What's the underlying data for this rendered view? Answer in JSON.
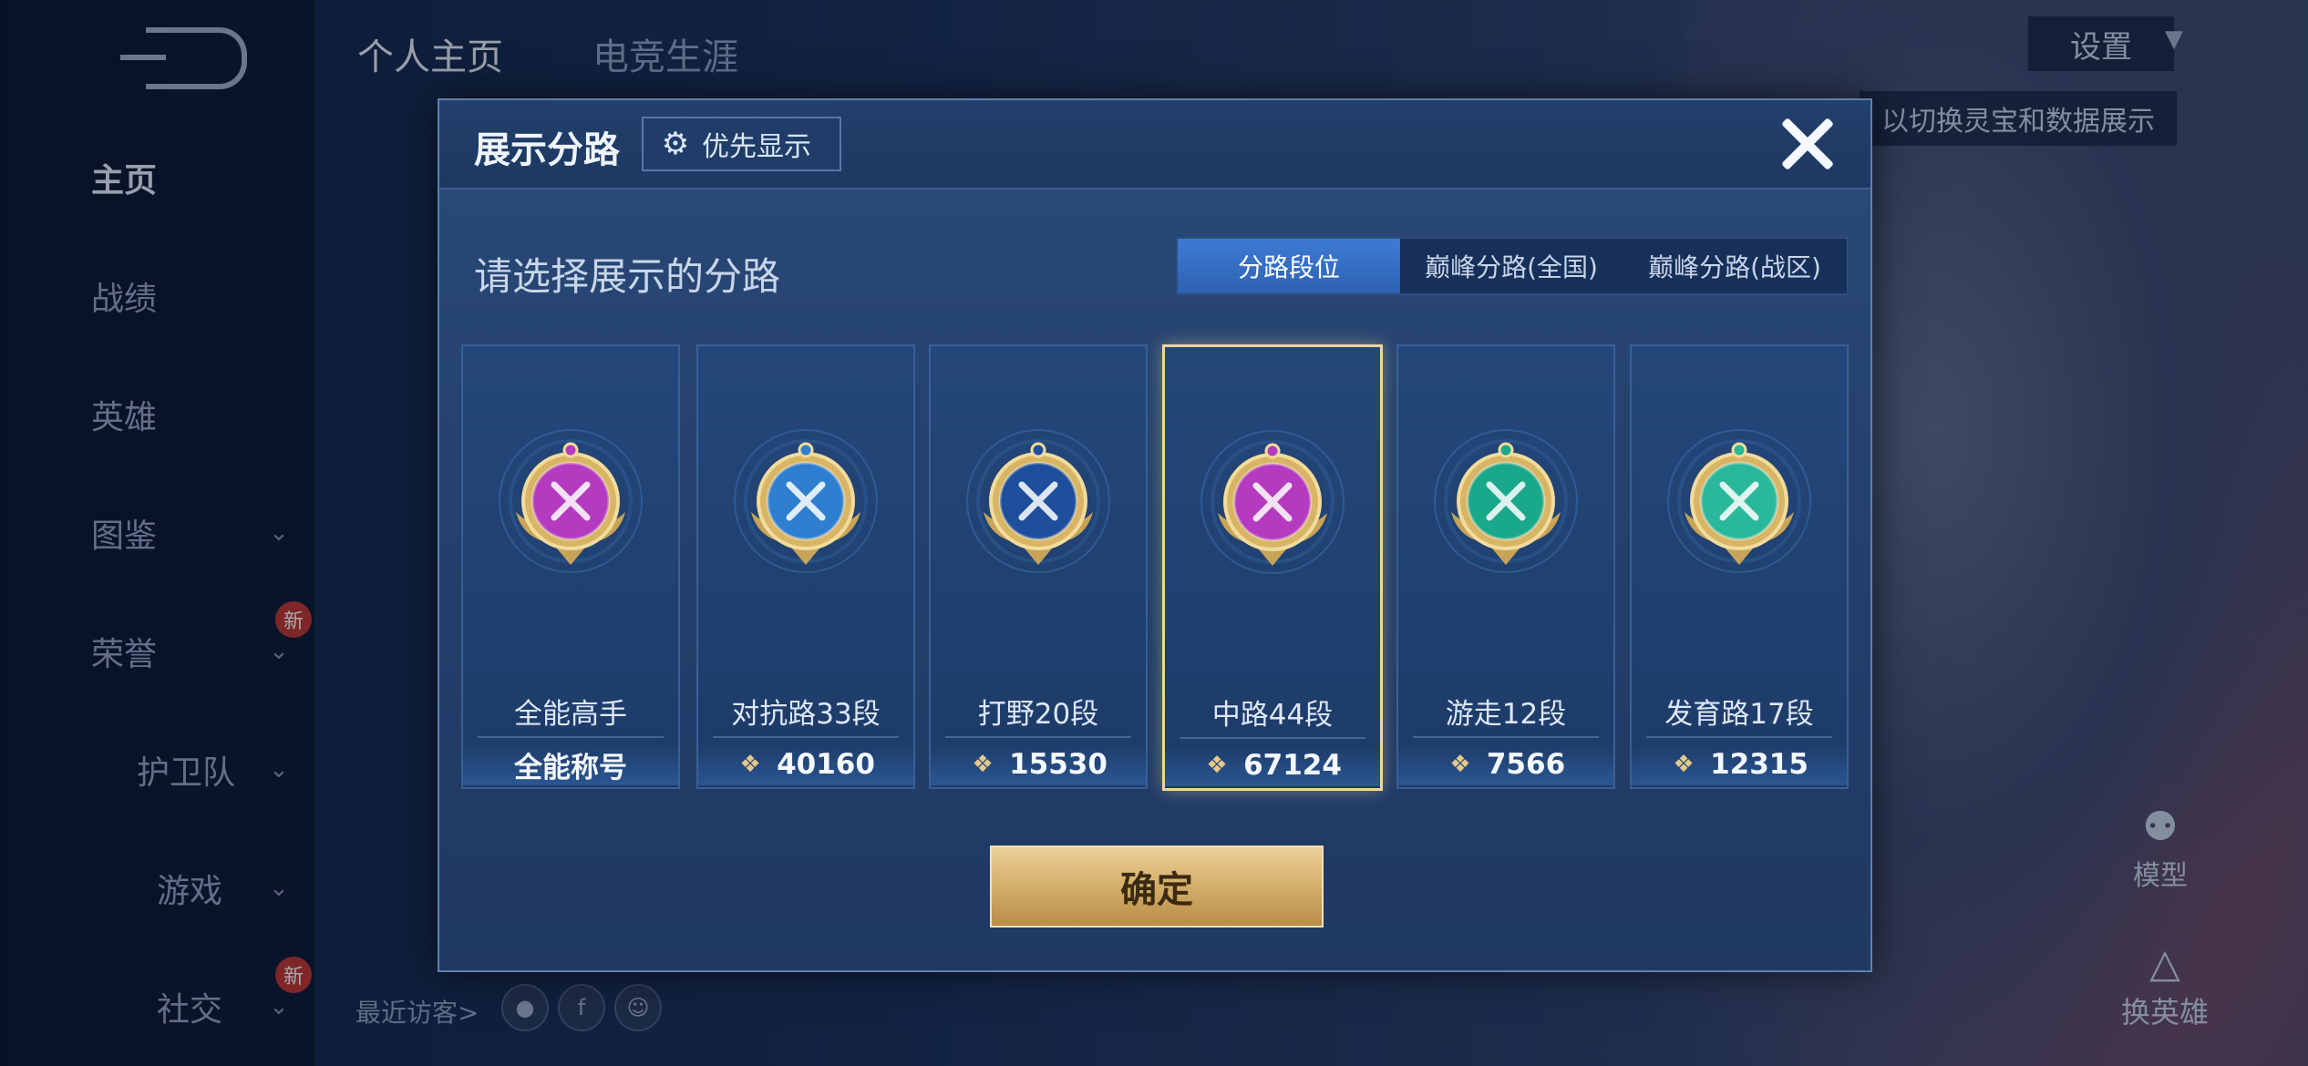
{
  "top_tabs": [
    "个人主页",
    "电竞生涯"
  ],
  "settings_label": "设置",
  "hint_text": "以切换灵宝和数据展示",
  "sidebar": {
    "items": [
      {
        "label": "主页"
      },
      {
        "label": "战绩"
      },
      {
        "label": "英雄"
      },
      {
        "label": "图鉴"
      },
      {
        "label": "荣誉"
      },
      {
        "label": "护卫队"
      },
      {
        "label": "游戏"
      },
      {
        "label": "社交"
      }
    ],
    "new_badge": "新"
  },
  "recent_visitors_label": "最近访客>",
  "model_label": "模型",
  "swap_hero_label": "换英雄",
  "modal": {
    "title": "展示分路",
    "priority_label": "优先显示",
    "prompt": "请选择展示的分路",
    "seg_tabs": [
      "分路段位",
      "巅峰分路(全国)",
      "巅峰分路(战区)"
    ],
    "active_seg": 0,
    "confirm_label": "确定",
    "cards": [
      {
        "name": "全能高手",
        "score": "全能称号",
        "color": "#b43ac0",
        "icon": "all-round-emblem-icon",
        "has_score_icon": false
      },
      {
        "name": "对抗路33段",
        "score": "40160",
        "color": "#2f7fd0",
        "icon": "clash-lane-emblem-icon",
        "has_score_icon": true
      },
      {
        "name": "打野20段",
        "score": "15530",
        "color": "#1d4f9c",
        "icon": "jungle-dragon-emblem-icon",
        "has_score_icon": true
      },
      {
        "name": "中路44段",
        "score": "67124",
        "color": "#b43ac0",
        "icon": "mid-lane-emblem-icon",
        "has_score_icon": true
      },
      {
        "name": "游走12段",
        "score": "7566",
        "color": "#1aa88a",
        "icon": "roam-wings-emblem-icon",
        "has_score_icon": true
      },
      {
        "name": "发育路17段",
        "score": "12315",
        "color": "#29b89a",
        "icon": "farm-lane-emblem-icon",
        "has_score_icon": true
      }
    ],
    "selected_card": 3
  }
}
